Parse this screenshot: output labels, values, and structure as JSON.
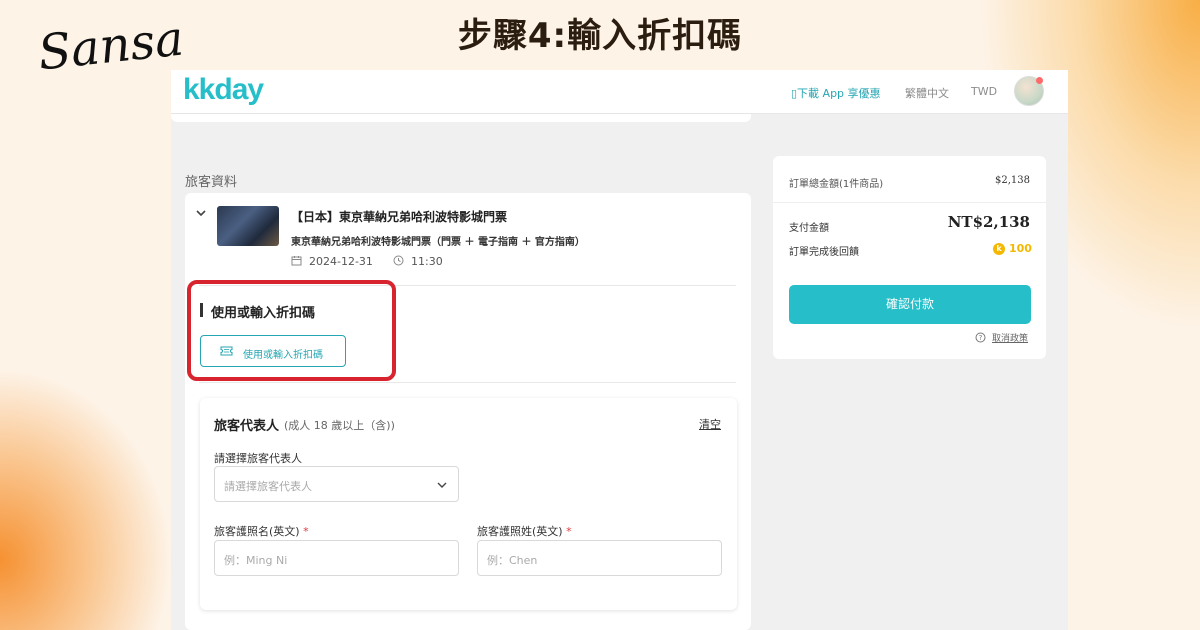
{
  "page": {
    "heading": "步驟4:輸入折扣碼",
    "brand_signature": "Sansa"
  },
  "topbar": {
    "logo": "kkday",
    "app_link": "▯下載 App 享優惠",
    "language": "繁體中文",
    "currency": "TWD",
    "avatar_icon": "user-avatar"
  },
  "traveler_section": {
    "title": "旅客資料",
    "product": {
      "title": "【日本】東京華納兄弟哈利波特影城門票",
      "subtitle": "東京華納兄弟哈利波特影城門票（門票 ＋ 電子指南 ＋ 官方指南）",
      "date": "2024-12-31",
      "time": "11:30"
    },
    "coupon": {
      "title": "使用或輸入折扣碼",
      "button_label": "使用或輸入折扣碼",
      "highlight_color": "#d7242f"
    },
    "representative": {
      "title": "旅客代表人",
      "note": "(成人 18 歲以上（含))",
      "clear_label": "清空",
      "select_label": "請選擇旅客代表人",
      "select_placeholder": "請選擇旅客代表人",
      "first_name_label": "旅客護照名(英文)",
      "first_name_placeholder": "例：Ming Ni",
      "last_name_label": "旅客護照姓(英文)",
      "last_name_placeholder": "例：Chen",
      "required_mark": "*"
    }
  },
  "summary": {
    "total_label": "訂單總金額(1件商品)",
    "total_value": "$2,138",
    "pay_label": "支付金額",
    "pay_value": "NT$2,138",
    "reward_label": "訂單完成後回饋",
    "reward_coin": "k",
    "reward_value": "100",
    "confirm_button": "確認付款",
    "policy_link": "取消政策"
  },
  "colors": {
    "accent": "#26bec9",
    "highlight": "#d7242f",
    "reward": "#f5b800"
  }
}
